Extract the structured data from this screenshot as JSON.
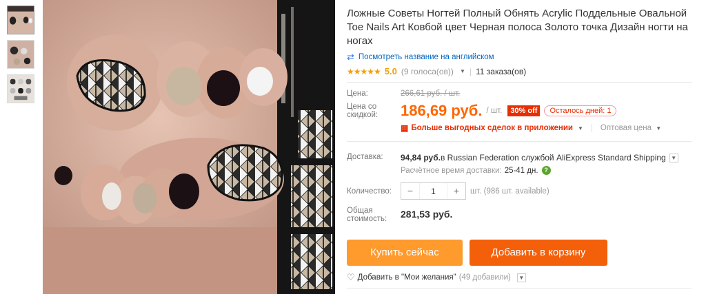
{
  "product": {
    "title": "Ложные Советы Ногтей Полный Обнять Acrylic Поддельные Овальной Toe Nails Art Ковбой цвет Черная полоса Золото точка Дизайн ногти на ногах",
    "translate_link": "Посмотреть название на английском",
    "stars": "★★★★★",
    "rating": "5.0",
    "votes": "(9 голоса(ов))",
    "orders": "11 заказа(ов)"
  },
  "price": {
    "label": "Цена:",
    "old_value": "266,61 руб. / шт.",
    "discount_label_1": "Цена со",
    "discount_label_2": "скидкой:",
    "new_value": "186,69 руб.",
    "per_unit": "/ шт.",
    "off_badge": "30% off",
    "days_left": "Осталось дней: 1",
    "app_deals": "Больше выгодных сделок в приложении",
    "wholesale": "Оптовая цена"
  },
  "shipping": {
    "label": "Доставка:",
    "cost": "94,84 руб.",
    "to_text": " в Russian Federation службой AliExpress Standard Shipping",
    "time_label": "Расчётное время доставки:",
    "time_value": "25-41 дн."
  },
  "quantity": {
    "label": "Количество:",
    "value": "1",
    "unit": "шт. (986 шт. available)",
    "minus": "−",
    "plus": "+"
  },
  "total": {
    "label_1": "Общая",
    "label_2": "стоимость:",
    "value": "281,53 руб."
  },
  "actions": {
    "buy_now": "Купить сейчас",
    "add_to_cart": "Добавить в корзину",
    "wishlist": "Добавить в \"Мои желания\"",
    "wishlist_count": "(49 добавили)"
  },
  "colors": {
    "price_orange": "#ff6600",
    "buy_button": "#ff9a2c",
    "cart_button": "#f45f0a",
    "badge_red": "#e62e04",
    "link_blue": "#0066c0"
  }
}
